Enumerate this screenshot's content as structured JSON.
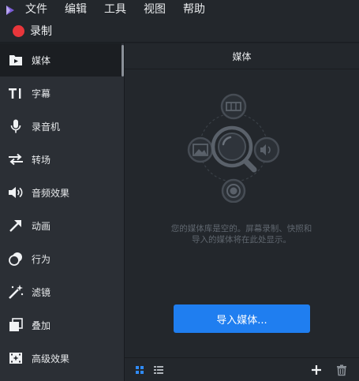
{
  "menubar": {
    "items": [
      "文件",
      "编辑",
      "工具",
      "视图",
      "帮助"
    ]
  },
  "record": {
    "label": "录制",
    "color": "#e8363b"
  },
  "sidebar": {
    "items": [
      {
        "label": "媒体",
        "icon": "media-icon",
        "active": true
      },
      {
        "label": "字幕",
        "icon": "text-icon"
      },
      {
        "label": "录音机",
        "icon": "microphone-icon"
      },
      {
        "label": "转场",
        "icon": "transition-icon"
      },
      {
        "label": "音频效果",
        "icon": "speaker-icon"
      },
      {
        "label": "动画",
        "icon": "arrow-icon"
      },
      {
        "label": "行为",
        "icon": "behavior-icon"
      },
      {
        "label": "滤镜",
        "icon": "magic-wand-icon"
      },
      {
        "label": "叠加",
        "icon": "overlay-icon"
      },
      {
        "label": "高级效果",
        "icon": "advanced-effects-icon"
      }
    ]
  },
  "main": {
    "title": "媒体",
    "empty_message": "您的媒体库是空的。屏幕录制、快照和导入的媒体将在此处显示。",
    "import_button": "导入媒体...",
    "accent": "#1f7ef0"
  }
}
